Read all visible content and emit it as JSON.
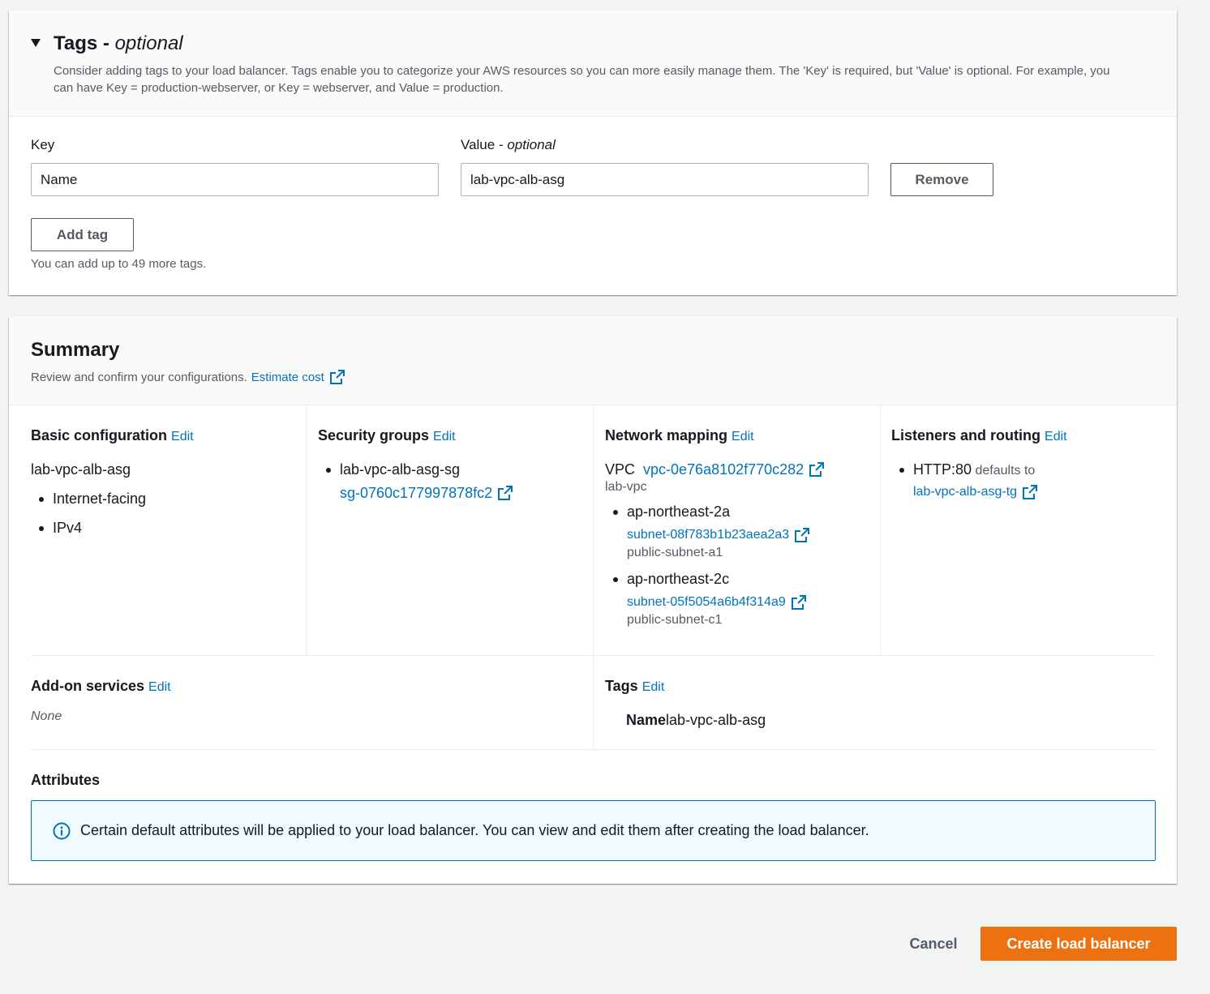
{
  "tags_section": {
    "title": "Tags - ",
    "title_optional": "optional",
    "description": "Consider adding tags to your load balancer. Tags enable you to categorize your AWS resources so you can more easily manage them. The 'Key' is required, but 'Value' is optional. For example, you can have Key = production-webserver, or Key = webserver, and Value = production.",
    "key_label": "Key",
    "value_label": "Value - ",
    "value_label_optional": "optional",
    "key_value": "Name",
    "value_value": "lab-vpc-alb-asg",
    "remove_label": "Remove",
    "add_tag_label": "Add tag",
    "hint": "You can add up to 49 more tags."
  },
  "summary": {
    "title": "Summary",
    "description": "Review and confirm your configurations.",
    "estimate_cost_link": "Estimate cost",
    "edit_label": "Edit",
    "basic": {
      "title": "Basic configuration",
      "name": "lab-vpc-alb-asg",
      "items": [
        "Internet-facing",
        "IPv4"
      ]
    },
    "security_groups": {
      "title": "Security groups",
      "group_name": "lab-vpc-alb-asg-sg",
      "group_id": "sg-0760c177997878fc2"
    },
    "network_mapping": {
      "title": "Network mapping",
      "vpc_label": "VPC",
      "vpc_id": "vpc-0e76a8102f770c282",
      "vpc_name": "lab-vpc",
      "zones": [
        {
          "az": "ap-northeast-2a",
          "subnet_id": "subnet-08f783b1b23aea2a3",
          "subnet_name": "public-subnet-a1"
        },
        {
          "az": "ap-northeast-2c",
          "subnet_id": "subnet-05f5054a6b4f314a9",
          "subnet_name": "public-subnet-c1"
        }
      ]
    },
    "listeners": {
      "title": "Listeners and routing",
      "listener": "HTTP:80",
      "defaults_to": "defaults to",
      "target_group": "lab-vpc-alb-asg-tg"
    },
    "addons": {
      "title": "Add-on services",
      "value": "None"
    },
    "tags": {
      "title": "Tags",
      "key": "Name",
      "value": "lab-vpc-alb-asg"
    },
    "attributes": {
      "title": "Attributes",
      "info": "Certain default attributes will be applied to your load balancer. You can view and edit them after creating the load balancer."
    }
  },
  "footer": {
    "cancel_label": "Cancel",
    "create_label": "Create load balancer"
  },
  "colors": {
    "link": "#0073bb",
    "primary": "#ec7211",
    "background": "#f2f3f3"
  }
}
